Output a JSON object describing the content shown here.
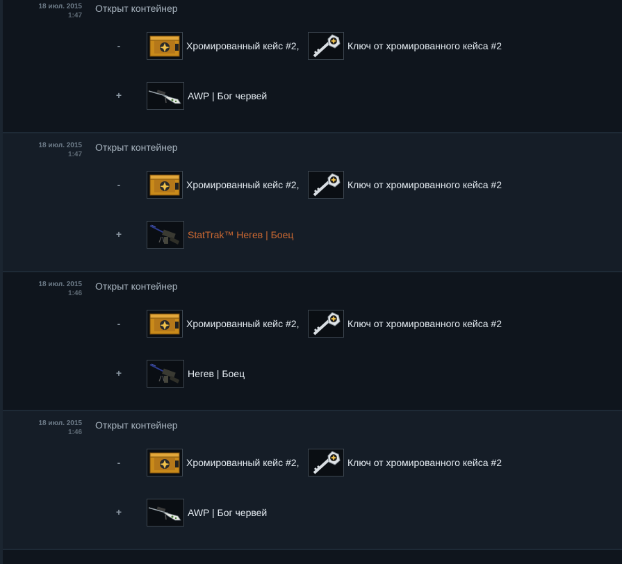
{
  "entries": [
    {
      "date": "18 июл. 2015",
      "time": "1:47",
      "description": "Открыт контейнер",
      "minus_sign": "-",
      "plus_sign": "+",
      "removed": [
        {
          "label": "Хромированный кейс #2,",
          "icon": "chroma-case-icon"
        },
        {
          "label": "Ключ от хромированного кейса #2",
          "icon": "case-key-icon"
        }
      ],
      "added": {
        "label": "AWP | Бог червей",
        "icon": "awp-rifle-icon",
        "stattrak": false
      }
    },
    {
      "date": "18 июл. 2015",
      "time": "1:47",
      "description": "Открыт контейнер",
      "minus_sign": "-",
      "plus_sign": "+",
      "removed": [
        {
          "label": "Хромированный кейс #2,",
          "icon": "chroma-case-icon"
        },
        {
          "label": "Ключ от хромированного кейса #2",
          "icon": "case-key-icon"
        }
      ],
      "added": {
        "label": "StatTrak™ Негев | Боец",
        "icon": "negev-machinegun-icon",
        "stattrak": true
      }
    },
    {
      "date": "18 июл. 2015",
      "time": "1:46",
      "description": "Открыт контейнер",
      "minus_sign": "-",
      "plus_sign": "+",
      "removed": [
        {
          "label": "Хромированный кейс #2,",
          "icon": "chroma-case-icon"
        },
        {
          "label": "Ключ от хромированного кейса #2",
          "icon": "case-key-icon"
        }
      ],
      "added": {
        "label": "Негев | Боец",
        "icon": "negev-machinegun-icon",
        "stattrak": false
      }
    },
    {
      "date": "18 июл. 2015",
      "time": "1:46",
      "description": "Открыт контейнер",
      "minus_sign": "-",
      "plus_sign": "+",
      "removed": [
        {
          "label": "Хромированный кейс #2,",
          "icon": "chroma-case-icon"
        },
        {
          "label": "Ключ от хромированного кейса #2",
          "icon": "case-key-icon"
        }
      ],
      "added": {
        "label": "AWP | Бог червей",
        "icon": "awp-rifle-icon",
        "stattrak": false
      }
    }
  ],
  "colors": {
    "stattrak": "#cf6a32",
    "row_dark": "#0f151d",
    "row_light": "#151d27"
  }
}
